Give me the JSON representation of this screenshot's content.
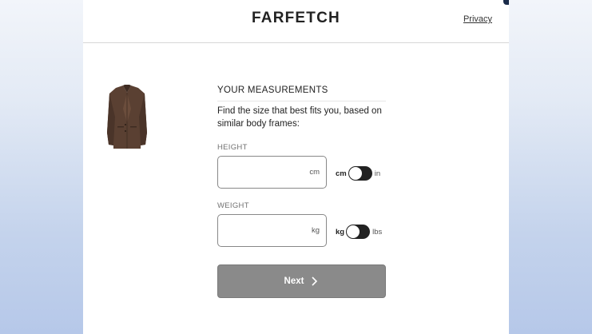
{
  "header": {
    "logo": "FARFETCH",
    "privacy_label": "Privacy"
  },
  "product": {
    "image_icon": "jacket-product-image"
  },
  "measurements": {
    "title": "YOUR MEASUREMENTS",
    "description": "Find the size that best fits you, based on similar body frames:",
    "height": {
      "label": "HEIGHT",
      "value": "",
      "unit_suffix": "cm",
      "unit_active": "cm",
      "unit_inactive": "in"
    },
    "weight": {
      "label": "WEIGHT",
      "value": "",
      "unit_suffix": "kg",
      "unit_active": "kg",
      "unit_inactive": "lbs"
    }
  },
  "next_button": {
    "label": "Next",
    "icon": "chevron-right-icon"
  },
  "colors": {
    "brand_text": "#222222",
    "button_disabled": "#8a8a8a",
    "toggle": "#222222"
  }
}
